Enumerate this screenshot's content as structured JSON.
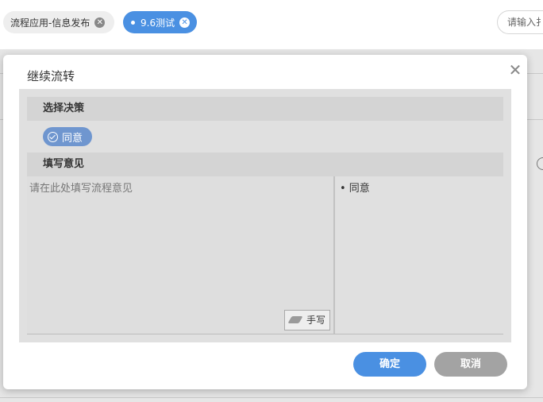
{
  "tabs": [
    {
      "label": "流程应用-信息发布"
    },
    {
      "label": "9.6测试"
    }
  ],
  "search": {
    "placeholder": "请输入扌"
  },
  "dialog": {
    "title": "继续流转",
    "sections": {
      "decision": "选择决策",
      "opinion": "填写意见"
    },
    "decision_option": "同意",
    "opinion_placeholder": "请在此处填写流程意见",
    "handwrite_label": "手写",
    "common_opinions": [
      "• 同意"
    ],
    "ok_label": "确定",
    "cancel_label": "取消"
  },
  "colors": {
    "accent": "#4a90e2",
    "chip": "#6f96cf",
    "cancel": "#a3a3a3"
  },
  "icons": [
    "close-icon",
    "check-circle-icon",
    "pen-icon",
    "tab-close-icon"
  ]
}
